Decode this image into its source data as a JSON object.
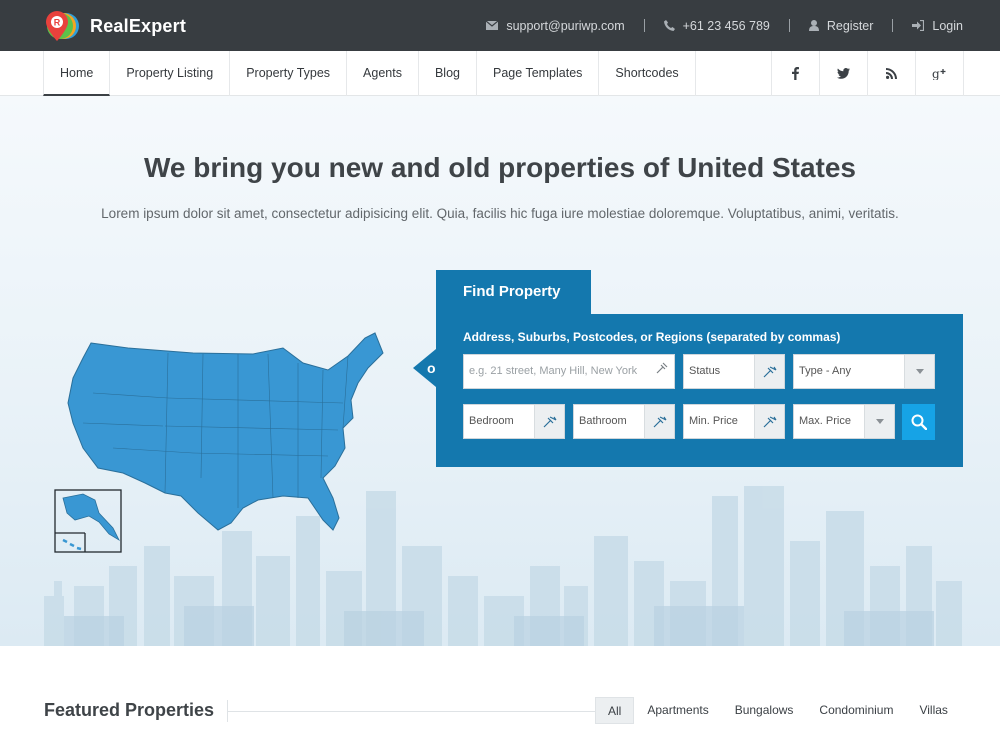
{
  "brand": {
    "name": "RealExpert",
    "logo_letter": "R"
  },
  "topbar": {
    "email": "support@puriwp.com",
    "phone": "+61 23 456 789",
    "register": "Register",
    "login": "Login"
  },
  "nav": {
    "items": [
      "Home",
      "Property Listing",
      "Property Types",
      "Agents",
      "Blog",
      "Page Templates",
      "Shortcodes"
    ],
    "active": "Home",
    "social": [
      "facebook-icon",
      "twitter-icon",
      "rss-icon",
      "google-plus-icon"
    ]
  },
  "hero": {
    "title": "We bring you new and old properties of United States",
    "subtitle": "Lorem ipsum dolor sit amet, consectetur adipisicing elit. Quia, facilis hic fuga iure molestiae doloremque. Voluptatibus, animi, veritatis."
  },
  "search": {
    "tab": "Find Property",
    "or_label": "or",
    "label": "Address, Suburbs, Postcodes, or Regions (separated by commas)",
    "address_placeholder": "e.g. 21 street, Many Hill, New York",
    "status": "Status",
    "type": "Type - Any",
    "bedroom": "Bedroom",
    "bathroom": "Bathroom",
    "min_price": "Min. Price",
    "max_price": "Max. Price"
  },
  "featured": {
    "title": "Featured Properties",
    "filters": [
      "All",
      "Apartments",
      "Bungalows",
      "Condominium",
      "Villas"
    ],
    "active": "All"
  },
  "colors": {
    "accent": "#1478ae",
    "search_button": "#16a3e6",
    "map_fill": "#3997d3",
    "topbar": "#383d41"
  }
}
